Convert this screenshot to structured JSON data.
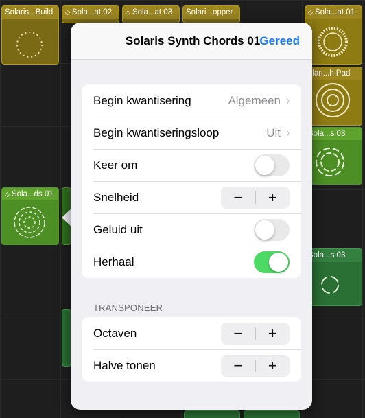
{
  "cells": {
    "c1": "Solaris...Build",
    "c2": "Sola...at 02",
    "c3": "Sola...at 03",
    "c4": "Solari...opper",
    "c5": "Sola...at 01",
    "c6": "olari...h Pad",
    "c7": "Sola...s 03",
    "c8": "Sola...ds 01",
    "c9": "Sola...s 03"
  },
  "popover": {
    "title": "Solaris Synth Chords 01",
    "done": "Gereed",
    "rows": {
      "start_quant": {
        "label": "Begin kwantisering",
        "value": "Algemeen"
      },
      "start_quant_loop": {
        "label": "Begin kwantiseringsloop",
        "value": "Uit"
      },
      "reverse": {
        "label": "Keer om",
        "on": false
      },
      "speed": {
        "label": "Snelheid",
        "minus": "−",
        "plus": "+"
      },
      "mute": {
        "label": "Geluid uit",
        "on": false
      },
      "loop": {
        "label": "Herhaal",
        "on": true
      }
    },
    "transpose": {
      "section": "TRANSPONEER",
      "octaves": {
        "label": "Octaven",
        "minus": "−",
        "plus": "+"
      },
      "semitones": {
        "label": "Halve tonen",
        "minus": "−",
        "plus": "+"
      }
    },
    "chevron": "›"
  },
  "colors": {
    "accent": "#1a7cf5",
    "toggle_on": "#4cd964"
  }
}
